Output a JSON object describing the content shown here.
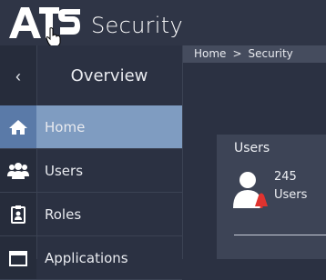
{
  "app": {
    "title": "Security"
  },
  "sidebar": {
    "collapse_glyph": "‹",
    "heading": "Overview",
    "items": [
      {
        "label": "Home",
        "icon": "home-icon",
        "active": true
      },
      {
        "label": "Users",
        "icon": "users-icon",
        "active": false
      },
      {
        "label": "Roles",
        "icon": "roles-icon",
        "active": false
      },
      {
        "label": "Applications",
        "icon": "applications-icon",
        "active": false
      }
    ]
  },
  "breadcrumb": {
    "items": [
      "Home",
      "Security"
    ],
    "separator": ">"
  },
  "cards": {
    "users": {
      "title": "Users",
      "count": "245",
      "label": "Users"
    }
  },
  "colors": {
    "accent": "#7f9cc1",
    "accent_dark": "#5a7aa8",
    "badge_red": "#e0332f",
    "background": "#2b3142",
    "card": "#3d4456"
  }
}
